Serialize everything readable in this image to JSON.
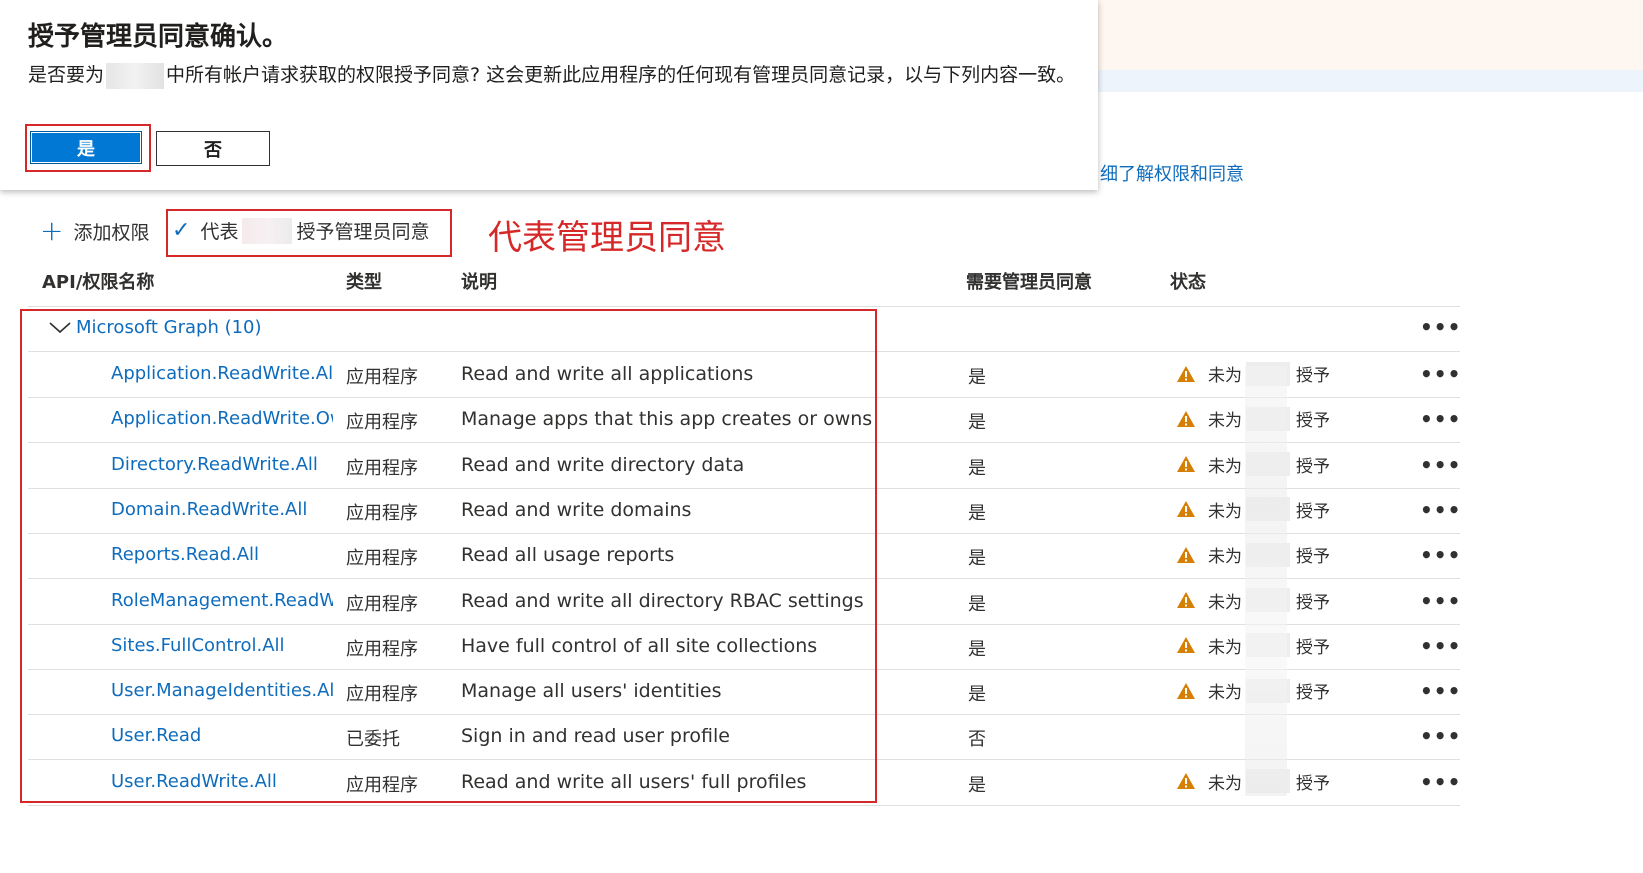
{
  "dialog": {
    "title": "授予管理员同意确认。",
    "text_before": "是否要为",
    "text_after": "中所有帐户请求获取的权限授予同意? 这会更新此应用程序的任何现有管理员同意记录，以与下列内容一致。",
    "yes_label": "是",
    "no_label": "否"
  },
  "background": {
    "learn_link": "细了解权限和同意"
  },
  "toolbar": {
    "add_label": "添加权限",
    "grant_prefix": "代表",
    "grant_suffix": "授予管理员同意"
  },
  "annotation": "代表管理员同意",
  "table": {
    "headers": {
      "name": "API/权限名称",
      "type": "类型",
      "desc": "说明",
      "admin": "需要管理员同意",
      "status": "状态"
    },
    "group": "Microsoft Graph (10)",
    "rows": [
      {
        "name": "Application.ReadWrite.All",
        "type": "应用程序",
        "desc": "Read and write all applications",
        "admin": "是",
        "status_prefix": "未为",
        "status_suffix": "授予",
        "warn": true
      },
      {
        "name": "Application.ReadWrite.OwnedBy",
        "type": "应用程序",
        "desc": "Manage apps that this app creates or owns",
        "admin": "是",
        "status_prefix": "未为",
        "status_suffix": "授予",
        "warn": true
      },
      {
        "name": "Directory.ReadWrite.All",
        "type": "应用程序",
        "desc": "Read and write directory data",
        "admin": "是",
        "status_prefix": "未为",
        "status_suffix": "授予",
        "warn": true
      },
      {
        "name": "Domain.ReadWrite.All",
        "type": "应用程序",
        "desc": "Read and write domains",
        "admin": "是",
        "status_prefix": "未为",
        "status_suffix": "授予",
        "warn": true
      },
      {
        "name": "Reports.Read.All",
        "type": "应用程序",
        "desc": "Read all usage reports",
        "admin": "是",
        "status_prefix": "未为",
        "status_suffix": "授予",
        "warn": true
      },
      {
        "name": "RoleManagement.ReadWrite.Directory",
        "type": "应用程序",
        "desc": "Read and write all directory RBAC settings",
        "admin": "是",
        "status_prefix": "未为",
        "status_suffix": "授予",
        "warn": true
      },
      {
        "name": "Sites.FullControl.All",
        "type": "应用程序",
        "desc": "Have full control of all site collections",
        "admin": "是",
        "status_prefix": "未为",
        "status_suffix": "授予",
        "warn": true
      },
      {
        "name": "User.ManageIdentities.All",
        "type": "应用程序",
        "desc": "Manage all users' identities",
        "admin": "是",
        "status_prefix": "未为",
        "status_suffix": "授予",
        "warn": true
      },
      {
        "name": "User.Read",
        "type": "已委托",
        "desc": "Sign in and read user profile",
        "admin": "否",
        "status_prefix": "",
        "status_suffix": "",
        "warn": false
      },
      {
        "name": "User.ReadWrite.All",
        "type": "应用程序",
        "desc": "Read and write all users' full profiles",
        "admin": "是",
        "status_prefix": "未为",
        "status_suffix": "授予",
        "warn": true
      }
    ]
  },
  "colors": {
    "link": "#0f6cbd",
    "primary": "#0078d4",
    "highlight": "#d62828",
    "warning": "#d67f05"
  },
  "icons": {
    "add": "plus-icon",
    "grant": "checkmark-icon",
    "expand": "chevron-down-icon",
    "status": "warning-icon",
    "actions": "more-icon"
  }
}
